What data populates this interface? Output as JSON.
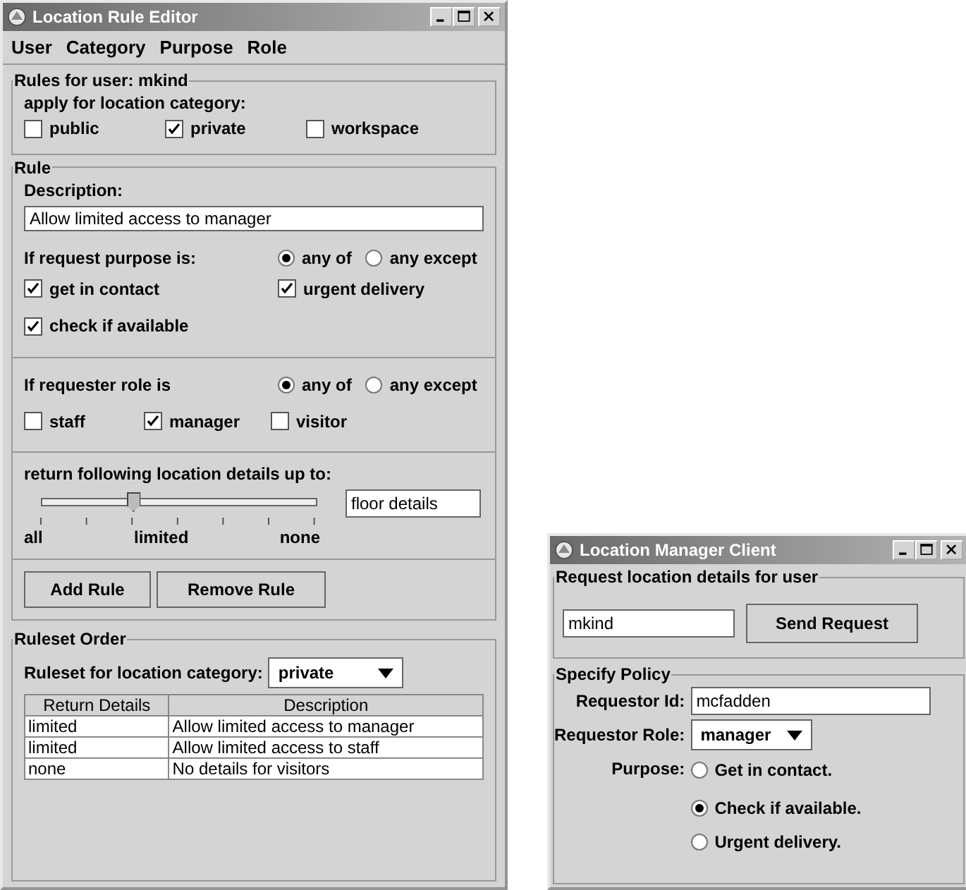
{
  "rule_editor": {
    "title": "Location Rule Editor",
    "menu": [
      "User",
      "Category",
      "Purpose",
      "Role"
    ],
    "user_rules": {
      "legend": "Rules for user: mkind",
      "prompt": "apply for location category:",
      "categories": [
        {
          "label": "public",
          "checked": false
        },
        {
          "label": "private",
          "checked": true
        },
        {
          "label": "workspace",
          "checked": false
        }
      ]
    },
    "rule": {
      "legend": "Rule",
      "description_label": "Description:",
      "description": "Allow limited access to manager",
      "purpose_label": "If request purpose is:",
      "purpose_mode": [
        {
          "label": "any of",
          "selected": true
        },
        {
          "label": "any except",
          "selected": false
        }
      ],
      "purposes": [
        {
          "label": "get in contact",
          "checked": true
        },
        {
          "label": "urgent delivery",
          "checked": true
        },
        {
          "label": "check if available",
          "checked": true
        }
      ],
      "role_label": "If requester role is",
      "role_mode": [
        {
          "label": "any of",
          "selected": true
        },
        {
          "label": "any except",
          "selected": false
        }
      ],
      "roles": [
        {
          "label": "staff",
          "checked": false
        },
        {
          "label": "manager",
          "checked": true
        },
        {
          "label": "visitor",
          "checked": false
        }
      ],
      "detail_label": "return following location details up to:",
      "detail_slider": {
        "level": 0.333
      },
      "detail_value": "floor details",
      "tick_labels": [
        "all",
        "limited",
        "none"
      ],
      "buttons": [
        "Add Rule",
        "Remove Rule"
      ]
    },
    "ruleset": {
      "legend": "Ruleset Order",
      "category_label": "Ruleset for location category:",
      "category": "private",
      "table": {
        "columns": [
          "Return Details",
          "Description"
        ],
        "rows": [
          [
            "limited",
            "Allow limited access to manager"
          ],
          [
            "limited",
            "Allow limited access to staff"
          ],
          [
            "none",
            "No details for visitors"
          ]
        ]
      }
    }
  },
  "manager_client": {
    "title": "Location Manager Client",
    "request": {
      "legend": "Request location details for user",
      "user": "mkind",
      "button": "Send Request"
    },
    "policy": {
      "legend": "Specify Policy",
      "id_label": "Requestor Id:",
      "id": "mcfadden",
      "role_label": "Requestor Role:",
      "role": "manager",
      "purpose_label": "Purpose:",
      "purposes": [
        {
          "label": "Get in contact.",
          "selected": false
        },
        {
          "label": "Check if available.",
          "selected": true
        },
        {
          "label": "Urgent delivery.",
          "selected": false
        }
      ]
    }
  }
}
